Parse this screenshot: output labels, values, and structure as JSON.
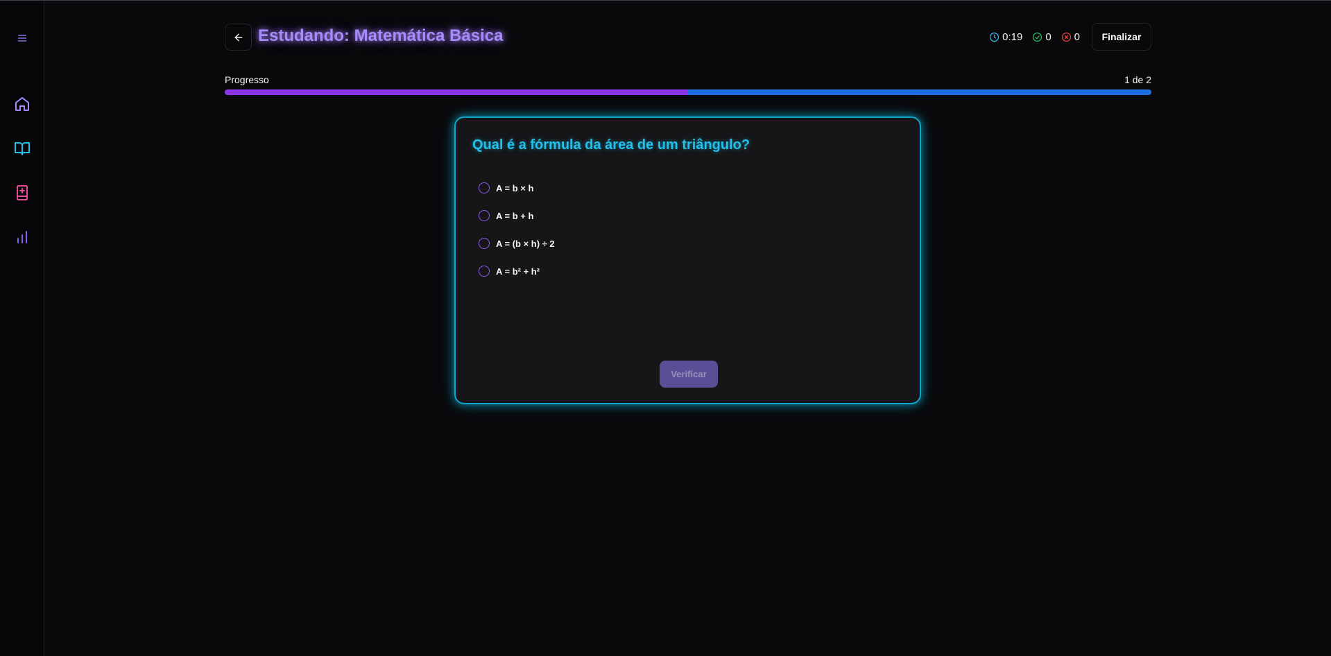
{
  "sidebar": {
    "items": [
      {
        "name": "menu",
        "icon": "menu-icon",
        "color": "#a78bfa"
      },
      {
        "name": "home",
        "icon": "home-icon",
        "color": "#a78bfa"
      },
      {
        "name": "study",
        "icon": "book-open-icon",
        "color": "#22c0ea"
      },
      {
        "name": "add-deck",
        "icon": "book-plus-icon",
        "color": "#ec4899"
      },
      {
        "name": "stats",
        "icon": "bar-chart-icon",
        "color": "#8b5cf6"
      }
    ]
  },
  "header": {
    "title": "Estudando: Matemática Básica",
    "timer": "0:19",
    "correct_count": "0",
    "wrong_count": "0",
    "finish_label": "Finalizar"
  },
  "progress": {
    "label": "Progresso",
    "count": "1 de 2",
    "fraction": 0.5
  },
  "quiz": {
    "question": "Qual é a fórmula da área de um triângulo?",
    "options": [
      {
        "label": "A = b × h"
      },
      {
        "label": "A = b + h"
      },
      {
        "label": "A = (b × h) ÷ 2"
      },
      {
        "label": "A = b² + h²"
      }
    ],
    "verify_label": "Verificar"
  },
  "colors": {
    "accent_purple": "#a78bfa",
    "accent_cyan": "#22c0ea",
    "correct_green": "#22c55e",
    "wrong_red": "#ef4444",
    "progress_fill": "#8b34e8",
    "progress_track": "#1d6fe0"
  }
}
